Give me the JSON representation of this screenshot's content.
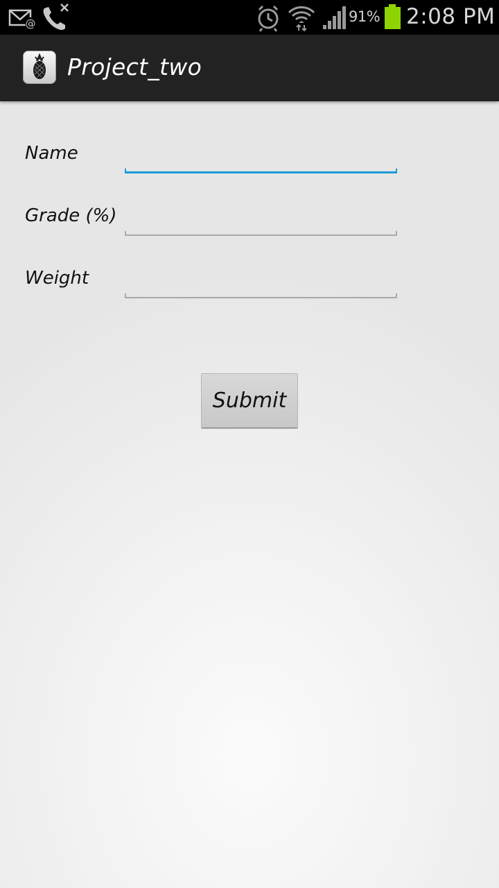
{
  "status_bar": {
    "icons": [
      "email-notification-icon",
      "missed-call-icon",
      "alarm-icon",
      "wifi-icon",
      "signal-icon",
      "battery-icon"
    ],
    "battery_percent": "91%",
    "battery_color": "#8ed400",
    "time": "2:08 PM"
  },
  "action_bar": {
    "app_icon": "pineapple-icon",
    "title": "Project_two"
  },
  "form": {
    "fields": [
      {
        "label": "Name",
        "value": "",
        "focused": true
      },
      {
        "label": "Grade (%)",
        "value": "",
        "focused": false
      },
      {
        "label": "Weight",
        "value": "",
        "focused": false
      }
    ],
    "submit_label": "Submit"
  },
  "colors": {
    "focus_accent": "#1a9bd7",
    "action_bar_bg": "#222222",
    "status_bar_bg": "#000000"
  }
}
